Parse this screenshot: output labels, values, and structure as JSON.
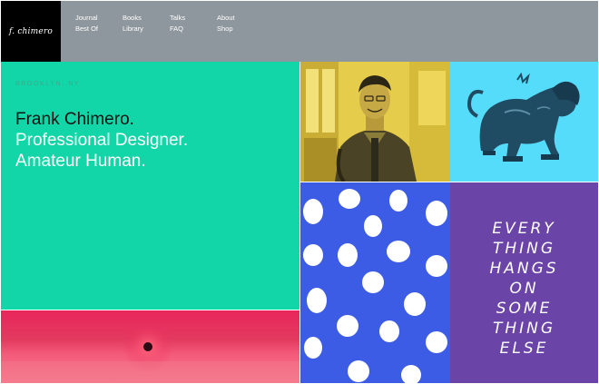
{
  "header": {
    "logo": "f. chimero",
    "nav": [
      [
        "Journal",
        "Best Of"
      ],
      [
        "Books",
        "Library"
      ],
      [
        "Talks",
        "FAQ"
      ],
      [
        "About",
        "Shop"
      ]
    ]
  },
  "hero": {
    "location": "BROOKLYN, NY",
    "line1": "Frank Chimero.",
    "line2": "Professional Designer.",
    "line3": "Amateur Human."
  },
  "lettering": {
    "lines": [
      "EVERY",
      "THING",
      "HANGS",
      "ON",
      "SOME",
      "THING",
      "ELSE"
    ]
  },
  "colors": {
    "header_bg": "#8f979e",
    "hero_bg": "#12d6a8",
    "portrait_bg": "#e5cc4a",
    "sculpture_bg": "#56dcfb",
    "dots_bg": "#3d5ce6",
    "lettering_bg": "#6b44a8",
    "sunset_bg": "#e8265a"
  }
}
